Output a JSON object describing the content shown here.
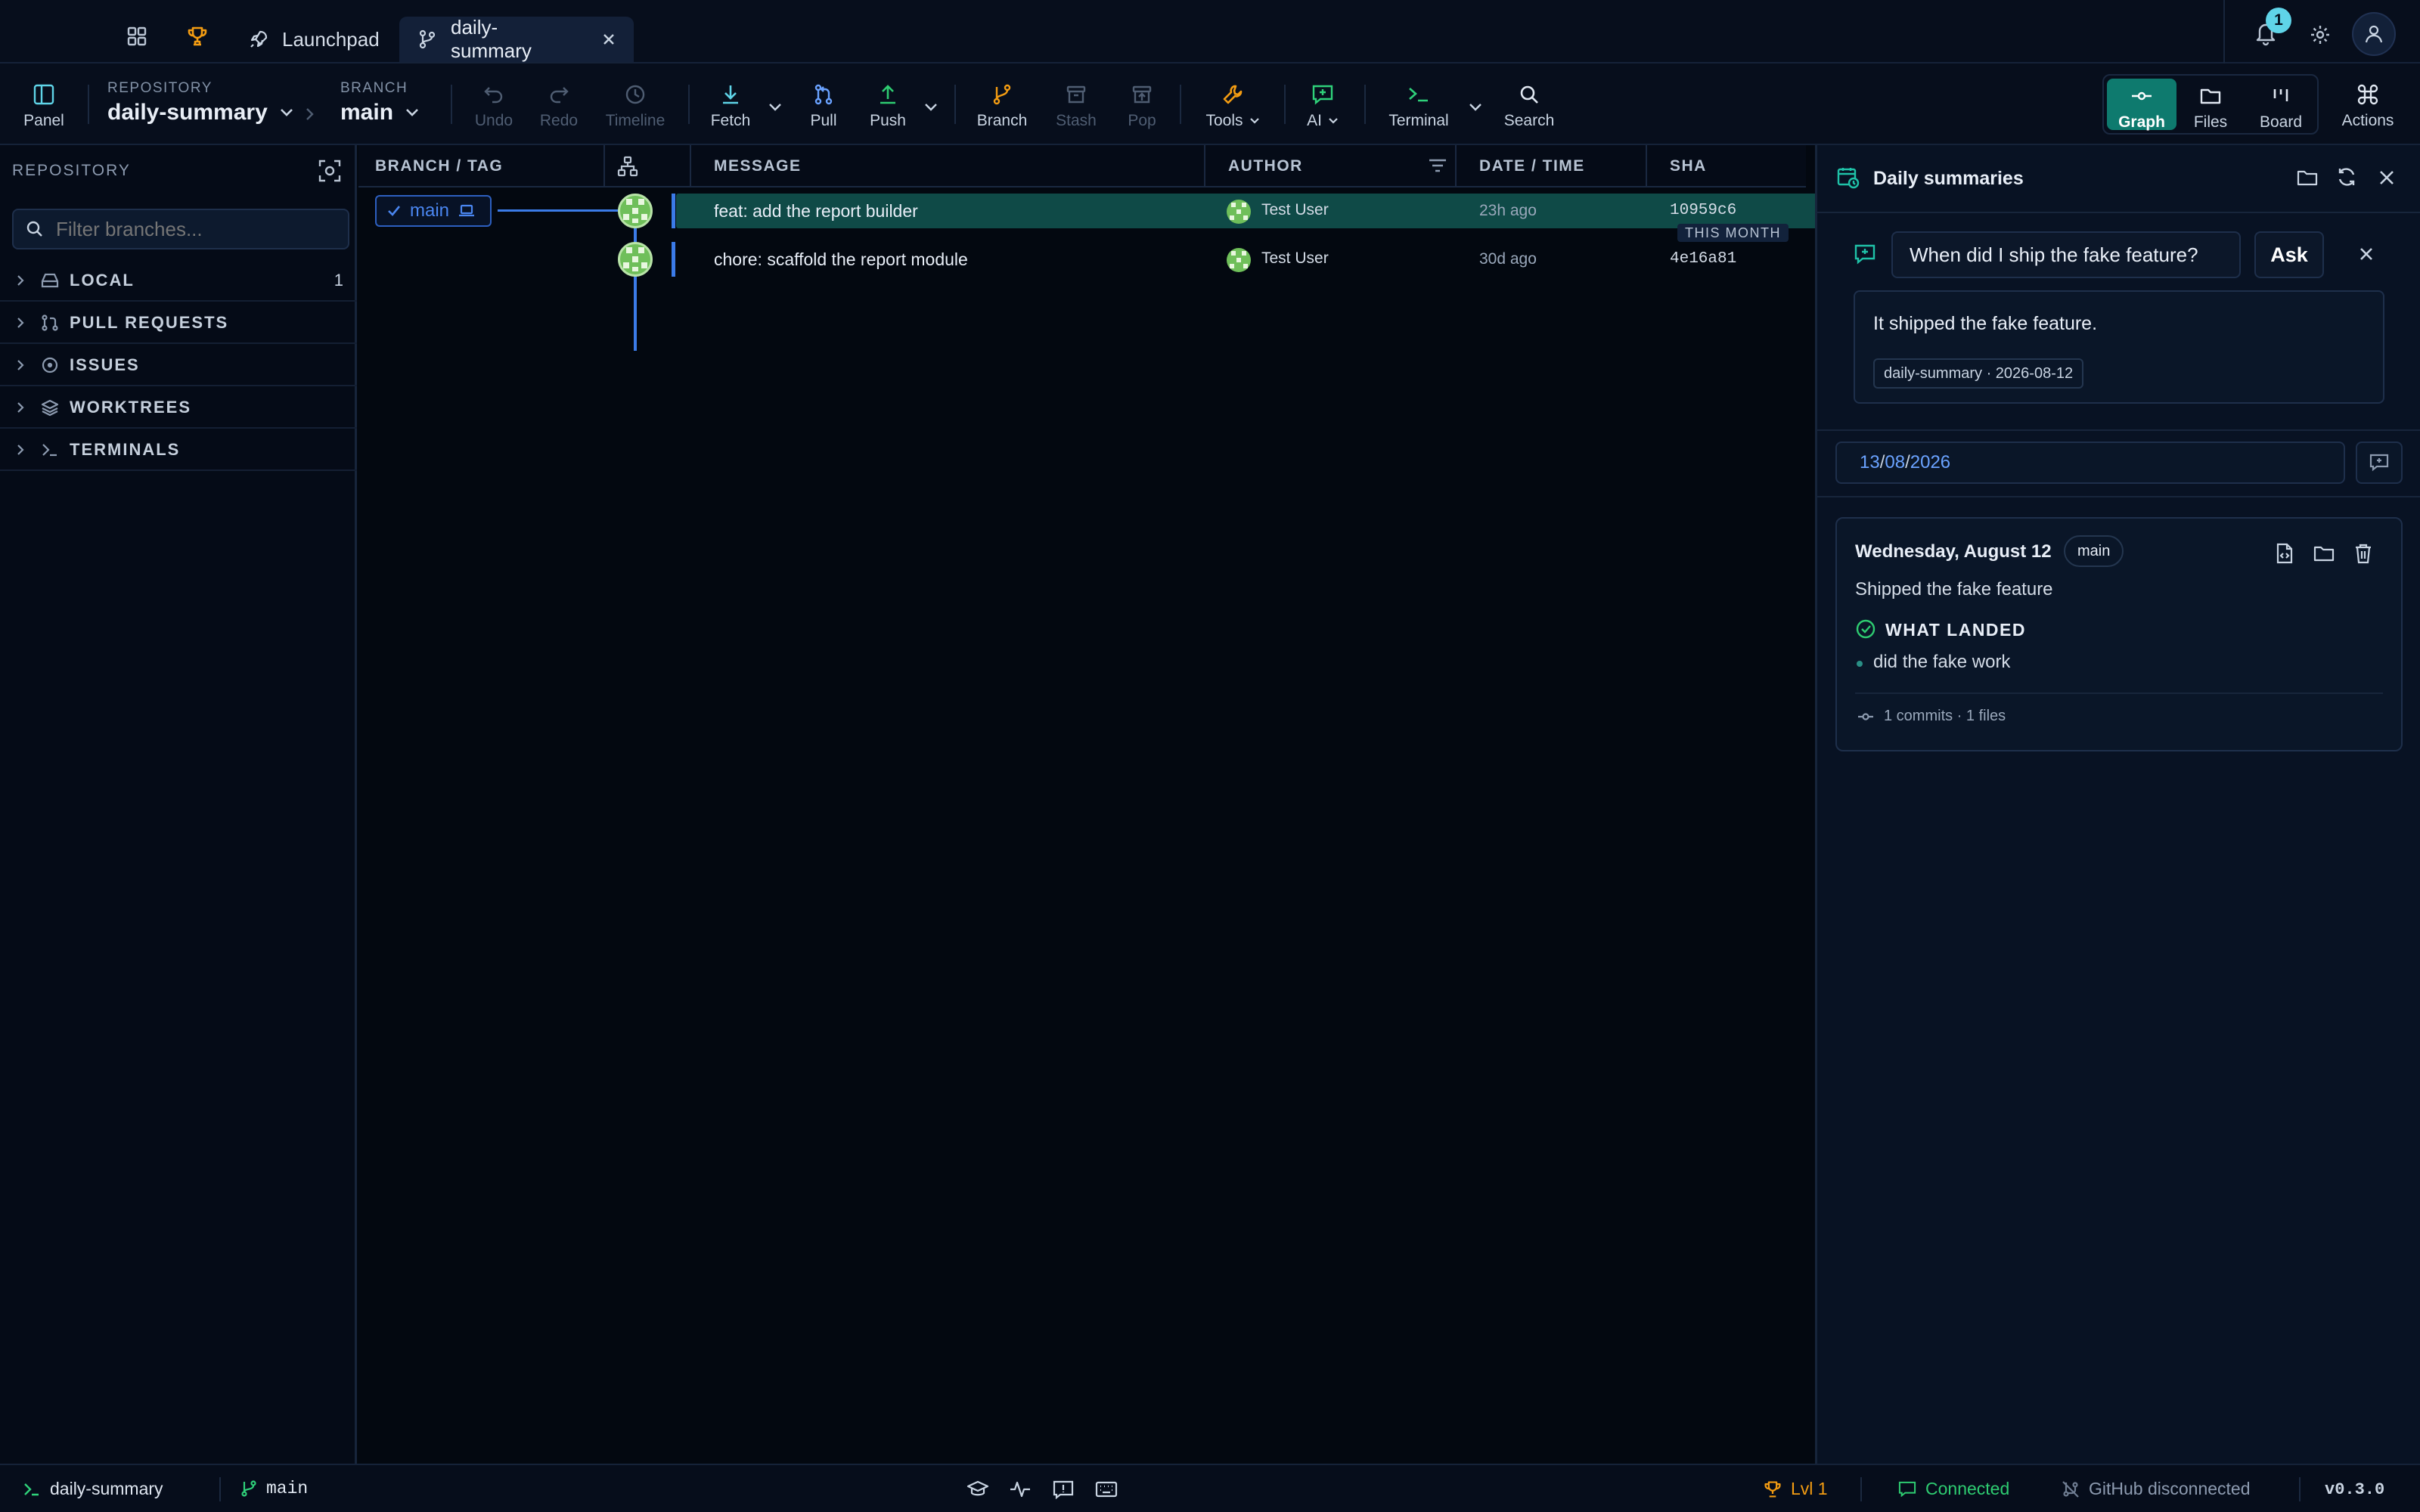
{
  "titlebar": {
    "tabs": [
      {
        "label": "Launchpad",
        "icon": "rocket-icon"
      },
      {
        "label": "daily-summary",
        "icon": "branch-icon",
        "active": true
      }
    ],
    "notification_count": "1"
  },
  "toolbar": {
    "panel_label": "Panel",
    "repository_caption": "REPOSITORY",
    "repository_name": "daily-summary",
    "branch_caption": "BRANCH",
    "branch_name": "main",
    "buttons": {
      "undo": "Undo",
      "redo": "Redo",
      "timeline": "Timeline",
      "fetch": "Fetch",
      "pull": "Pull",
      "push": "Push",
      "branch": "Branch",
      "stash": "Stash",
      "pop": "Pop",
      "tools": "Tools",
      "ai": "AI",
      "terminal": "Terminal",
      "search": "Search"
    },
    "views": {
      "graph": "Graph",
      "files": "Files",
      "board": "Board",
      "actions": "Actions"
    }
  },
  "sidebar": {
    "title": "REPOSITORY",
    "filter_placeholder": "Filter branches...",
    "sections": [
      {
        "label": "LOCAL",
        "count": "1",
        "icon": "drive-icon"
      },
      {
        "label": "PULL REQUESTS",
        "count": "",
        "icon": "pull-request-icon"
      },
      {
        "label": "ISSUES",
        "count": "",
        "icon": "issue-icon"
      },
      {
        "label": "WORKTREES",
        "count": "",
        "icon": "layers-icon"
      },
      {
        "label": "TERMINALS",
        "count": "",
        "icon": "terminal-icon"
      }
    ]
  },
  "graph": {
    "columns": {
      "branch_tag": "BRANCH / TAG",
      "message": "MESSAGE",
      "author": "AUTHOR",
      "date_time": "DATE / TIME",
      "sha": "SHA"
    },
    "branch_label": "main",
    "month_marker": "THIS MONTH",
    "commits": [
      {
        "message": "feat: add the report builder",
        "author": "Test User",
        "date": "23h ago",
        "sha": "10959c6"
      },
      {
        "message": "chore: scaffold the report module",
        "author": "Test User",
        "date": "30d ago",
        "sha": "4e16a81"
      }
    ]
  },
  "summaries": {
    "title": "Daily summaries",
    "ask_input_value": "When did I ship the fake feature?",
    "ask_button": "Ask",
    "answer": "It shipped the fake feature.",
    "citation": "daily-summary · 2026-08-12",
    "date_day": "13",
    "date_month": "08",
    "date_year": "2026",
    "card": {
      "date_title": "Wednesday, August 12",
      "branch_badge": "main",
      "headline": "Shipped the fake feature",
      "section_title": "WHAT LANDED",
      "items": [
        "did the fake work"
      ],
      "footer": "1 commits · 1 files"
    }
  },
  "statusbar": {
    "repo": "daily-summary",
    "branch": "main",
    "level": "Lvl 1",
    "connection": "Connected",
    "github": "GitHub disconnected",
    "version": "v0.3.0"
  },
  "colors": {
    "accent_teal": "#1a9e8f",
    "selected_row": "#0f4a47",
    "branch_blue": "#3b7be8",
    "warning_orange": "#f39c12",
    "connected_green": "#2ecc71"
  }
}
